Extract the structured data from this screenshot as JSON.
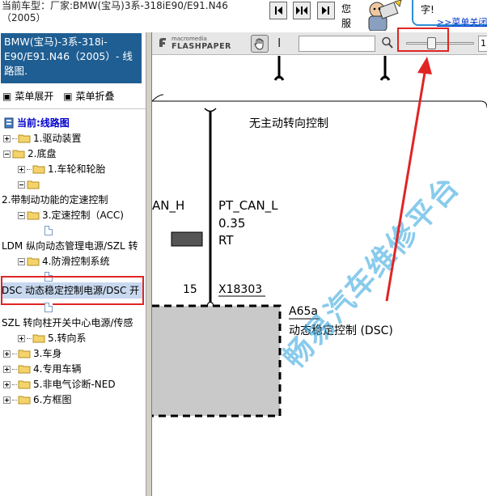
{
  "header": {
    "car_model_line": "当前车型：厂家:BMW(宝马)3系-318iE90/E91.N46",
    "car_year_line": "（2005）",
    "greeting": "您服",
    "bubble_text": "字!",
    "bubble_link": ">>菜单关闭"
  },
  "sidebar": {
    "title": "BMW(宝马)-3系-318i-E90/E91.N46（2005）- 线路图.",
    "expand_label": "菜单展开",
    "collapse_label": "菜单折叠",
    "tree": [
      {
        "label": "当前:线路图",
        "type": "current"
      },
      {
        "label": "1.驱动装置",
        "type": "folder"
      },
      {
        "label": "2.底盘",
        "type": "folder"
      },
      {
        "label": "1.车轮和轮胎",
        "type": "folder"
      },
      {
        "label": "",
        "type": "folder"
      },
      {
        "label": "2.带制动功能的定速控制",
        "type": "text"
      },
      {
        "label": "3.定速控制（ACC)",
        "type": "folder"
      },
      {
        "label": "",
        "type": "doc"
      },
      {
        "label": "LDM 纵向动态管理电源/SZL 转",
        "type": "text"
      },
      {
        "label": "4.防滑控制系统",
        "type": "folder"
      },
      {
        "label": "",
        "type": "doc"
      },
      {
        "label": "DSC 动态稳定控制电源/DSC 开",
        "type": "text-selected"
      },
      {
        "label": "",
        "type": "doc"
      },
      {
        "label": "SZL 转向柱开关中心电源/传感",
        "type": "text"
      },
      {
        "label": "5.转向系",
        "type": "folder"
      },
      {
        "label": "3.车身",
        "type": "folder"
      },
      {
        "label": "4.专用车辆",
        "type": "folder"
      },
      {
        "label": "5.非电气诊断-NED",
        "type": "folder"
      },
      {
        "label": "6.方框图",
        "type": "folder"
      }
    ]
  },
  "toolbar": {
    "logo_small": "macromedia",
    "logo_big": "FLASHPAPER",
    "zoom_value": "1",
    "zoom_level": 0.35
  },
  "diagram": {
    "heading": "无主动转向控制",
    "left_wire_label": "AN_H",
    "right_wire_label": "PT_CAN_L",
    "wire_size": "0.35",
    "wire_color": "RT",
    "pin_number": "15",
    "connector": "X18303",
    "module_id": "A65a",
    "module_name": "动态稳定控制 (DSC)"
  },
  "watermark": {
    "text": "畅易汽车维修平台"
  },
  "colors": {
    "title_bg": "#1f5e92",
    "highlight_red": "#e02525",
    "current_blue": "#0000cc",
    "watermark": "#28a0dc"
  }
}
